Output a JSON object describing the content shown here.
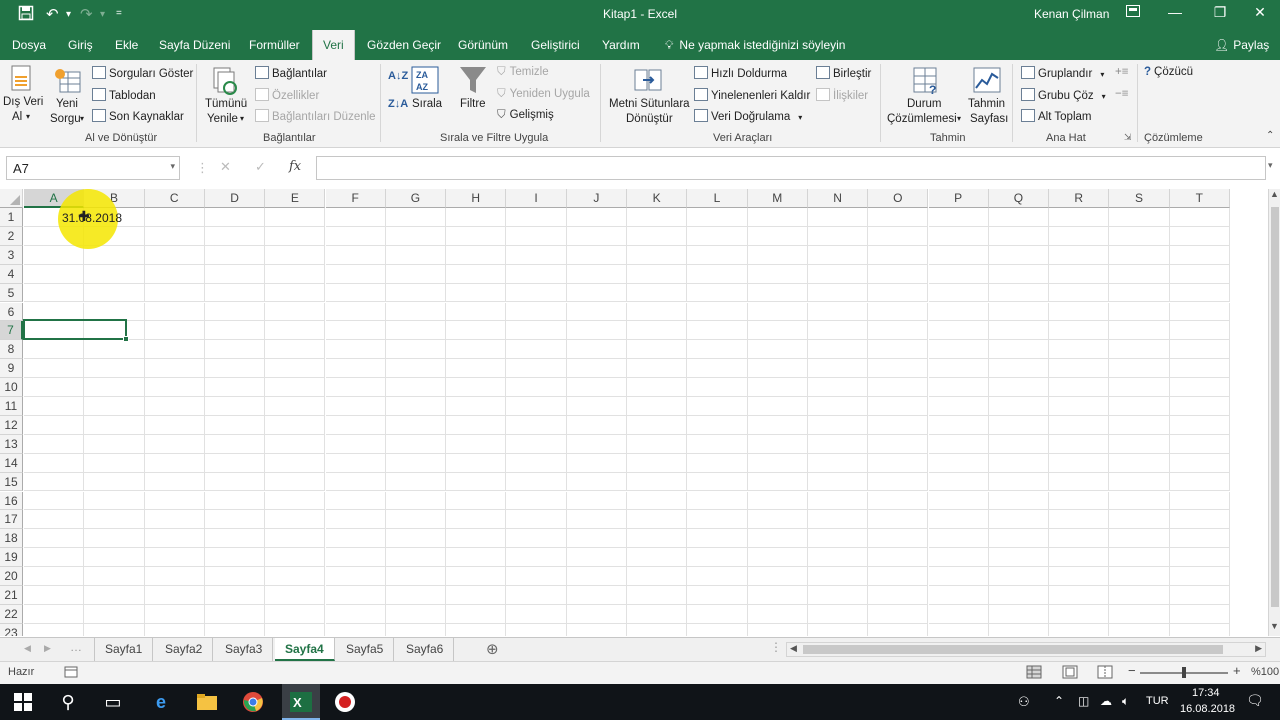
{
  "window": {
    "title": "Kitap1 - Excel",
    "user": "Kenan Çilman"
  },
  "menu": {
    "tabs": [
      "Dosya",
      "Giriş",
      "Ekle",
      "Sayfa Düzeni",
      "Formüller",
      "Veri",
      "Gözden Geçir",
      "Görünüm",
      "Geliştirici",
      "Yardım"
    ],
    "active": "Veri",
    "tell_me": "Ne yapmak istediğinizi söyleyin",
    "share": "Paylaş"
  },
  "ribbon": {
    "get_data": {
      "l1": "Dış Veri",
      "l2": "Al"
    },
    "new_query": {
      "l1": "Yeni",
      "l2": "Sorgu"
    },
    "show_queries": "Sorguları Göster",
    "from_table": "Tablodan",
    "recent_sources": "Son Kaynaklar",
    "group_get": "Al ve Dönüştür",
    "refresh_all": {
      "l1": "Tümünü",
      "l2": "Yenile"
    },
    "connections": "Bağlantılar",
    "properties": "Özellikler",
    "edit_links": "Bağlantıları Düzenle",
    "group_connections": "Bağlantılar",
    "sort": "Sırala",
    "filter": "Filtre",
    "clear": "Temizle",
    "reapply": "Yeniden Uygula",
    "advanced": "Gelişmiş",
    "group_sort": "Sırala ve Filtre Uygula",
    "text_to_columns": {
      "l1": "Metni Sütunlara",
      "l2": "Dönüştür"
    },
    "flash_fill": "Hızlı Doldurma",
    "remove_dup": "Yinelenenleri Kaldır",
    "validation": "Veri Doğrulama",
    "consolidate": "Birleştir",
    "relationships": "İlişkiler",
    "group_tools": "Veri Araçları",
    "what_if": {
      "l1": "Durum",
      "l2": "Çözümlemesi"
    },
    "forecast_sheet": {
      "l1": "Tahmin",
      "l2": "Sayfası"
    },
    "group_forecast": "Tahmin",
    "group_btn": "Gruplandır",
    "ungroup": "Grubu Çöz",
    "subtotal": "Alt Toplam",
    "group_outline": "Ana Hat",
    "solver": "Çözücü",
    "group_analysis": "Çözümleme"
  },
  "formula_bar": {
    "name_box": "A7",
    "fx": "fx",
    "value": ""
  },
  "grid": {
    "columns": [
      "A",
      "B",
      "C",
      "D",
      "E",
      "F",
      "G",
      "H",
      "I",
      "J",
      "K",
      "L",
      "M",
      "N",
      "O",
      "P",
      "Q",
      "R",
      "S",
      "T"
    ],
    "rows": [
      "1",
      "2",
      "3",
      "4",
      "5",
      "6",
      "7",
      "8",
      "9",
      "10",
      "11",
      "12",
      "13",
      "14",
      "15",
      "16",
      "17",
      "18",
      "19",
      "20",
      "21",
      "22",
      "23"
    ],
    "cell_A1": "31.08.2018",
    "selected_cell": "A7"
  },
  "sheets": {
    "tabs": [
      "Sayfa1",
      "Sayfa2",
      "Sayfa3",
      "Sayfa4",
      "Sayfa5",
      "Sayfa6"
    ],
    "active": "Sayfa4"
  },
  "status": {
    "ready": "Hazır",
    "zoom": "%100"
  },
  "taskbar": {
    "lang": "TUR",
    "time": "17:34",
    "date": "16.08.2018"
  },
  "colors": {
    "excel_green": "#217346",
    "highlight": "#f5e600"
  }
}
